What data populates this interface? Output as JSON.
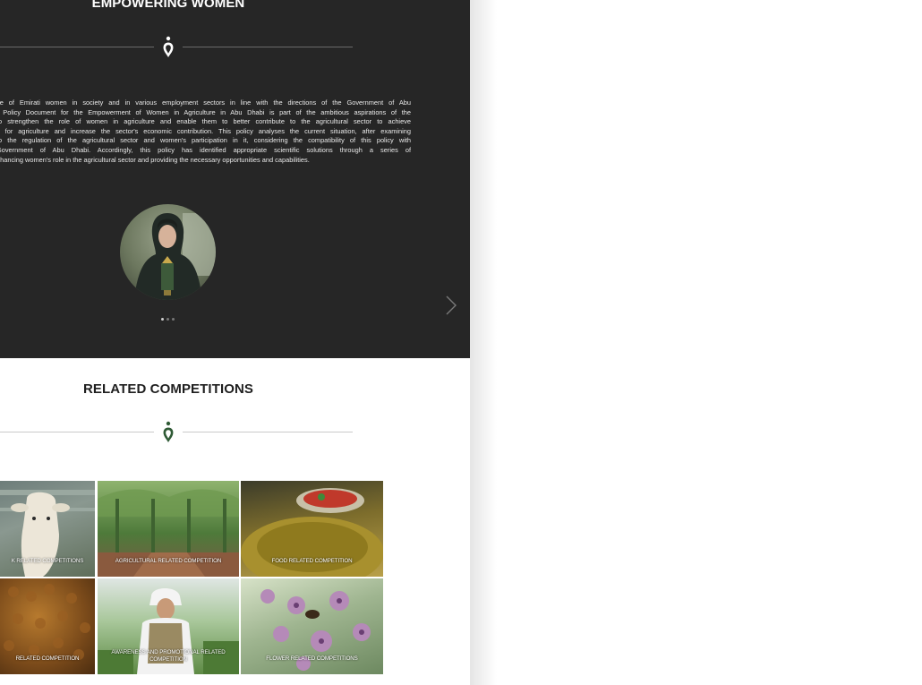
{
  "sections": {
    "empowering": {
      "title": "EMPOWERING WOMEN",
      "paragraph_lines": [
        "ce of Emirati women in society and in various employment sectors in line with the directions of the Government of Abu",
        "l Policy Document for the Empowerment of Women in Agriculture in Abu Dhabi is part of the ambitious aspirations of the",
        "to strengthen the role of women in agriculture and enable them to better contribute to the agricultural sector to achieve",
        "s for agriculture and increase the sector's economic contribution. This policy analyses the current situation, after examining",
        "to the regulation of the agricultural sector and women's participation in it, considering the compatibility of this policy with",
        "Government of Abu Dhabi. Accordingly, this policy has identified appropriate scientific solutions through a series of",
        "nhancing women's role in the agricultural sector and providing the necessary opportunities and capabilities."
      ],
      "carousel": {
        "total_slides": 3,
        "active_index": 0
      }
    },
    "competitions": {
      "title": "RELATED COMPETITIONS",
      "tiles": [
        {
          "label": "K RELATED COMPETITIONS"
        },
        {
          "label": "AGRICULTURAL RELATED COMPETITION"
        },
        {
          "label": "FOOD RELATED COMPETITION"
        },
        {
          "label": "RELATED COMPETITION"
        },
        {
          "label_line1": "AWARENESS AND PROMOTIONAL RELATED",
          "label_line2": "COMPETITION"
        },
        {
          "label": "FLOWER RELATED COMPETITIONS"
        }
      ]
    }
  },
  "colors": {
    "dark_section_bg": "#262626",
    "emblem_green": "#2f5a35",
    "page_bg": "#ffffff"
  },
  "icons": {
    "divider_emblem": "ornament-icon",
    "carousel_next": "chevron-right-icon"
  }
}
